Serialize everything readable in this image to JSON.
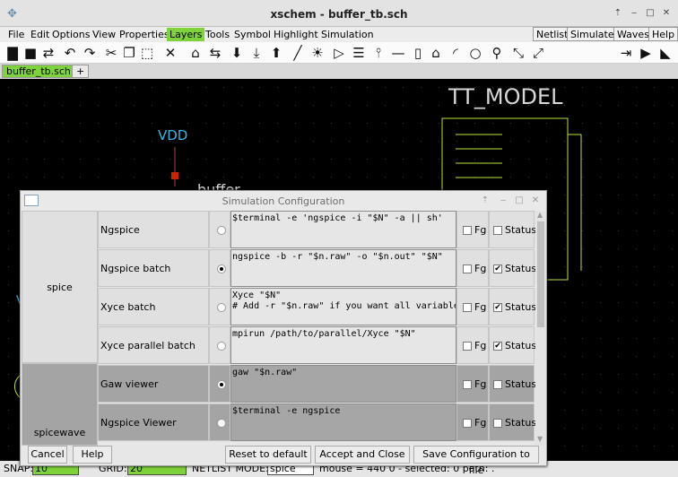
{
  "window": {
    "title": "xschem - buffer_tb.sch"
  },
  "menus": [
    "File",
    "Edit",
    "Options",
    "View",
    "Properties",
    "Layers",
    "Tools",
    "Symbol",
    "Highlight",
    "Simulation"
  ],
  "active_menu": "Layers",
  "right_buttons": [
    "Netlist",
    "Simulate",
    "Waves",
    "Help"
  ],
  "tabs": {
    "active": "buffer_tb.sch",
    "add": "+"
  },
  "schematic": {
    "model_label": "TT_MODEL",
    "vdd_label": "VDD",
    "partial_text": "buffer",
    "left_fragment": "V"
  },
  "status": {
    "snap_label": "SNAP:",
    "snap_value": "10",
    "grid_label": "GRID:",
    "grid_value": "20",
    "netlist_label": "NETLIST MODE:",
    "netlist_value": "spice",
    "rest": "mouse = 440 0 - selected: 0 path: ."
  },
  "dialog": {
    "title": "Simulation Configuration",
    "groups": [
      {
        "name": "spice"
      },
      {
        "name": "spicewave"
      }
    ],
    "rows": [
      {
        "name": "Ngspice",
        "selected": false,
        "cmd": "$terminal -e 'ngspice -i \"$N\" -a || sh'",
        "fg": false,
        "fg_label": "Fg",
        "status": false,
        "status_label": "Status"
      },
      {
        "name": "Ngspice batch",
        "selected": true,
        "cmd": "ngspice -b -r \"$n.raw\" -o \"$n.out\" \"$N\"",
        "fg": false,
        "fg_label": "Fg",
        "status": true,
        "status_label": "Status"
      },
      {
        "name": "Xyce batch",
        "selected": false,
        "cmd": "Xyce \"$N\"\n# Add -r \"$n.raw\" if you want all variables",
        "fg": false,
        "fg_label": "Fg",
        "status": true,
        "status_label": "Status"
      },
      {
        "name": "Xyce parallel batch",
        "selected": false,
        "cmd": "mpirun /path/to/parallel/Xyce \"$N\"",
        "fg": false,
        "fg_label": "Fg",
        "status": true,
        "status_label": "Status"
      },
      {
        "name": "Gaw viewer",
        "selected": true,
        "cmd": "gaw \"$n.raw\"",
        "fg": false,
        "fg_label": "Fg",
        "status": false,
        "status_label": "Status"
      },
      {
        "name": "Ngspice Viewer",
        "selected": false,
        "cmd": "$terminal -e ngspice",
        "fg": false,
        "fg_label": "Fg",
        "status": false,
        "status_label": "Status"
      }
    ],
    "buttons": {
      "cancel": "Cancel",
      "help": "Help",
      "reset": "Reset to default",
      "accept": "Accept and Close",
      "save": "Save Configuration to file"
    }
  },
  "colors": {
    "accent": "#7fd33a",
    "model": "#b6e23a",
    "vdd": "#38b6e6",
    "dark_row": "#a4a4a4"
  }
}
